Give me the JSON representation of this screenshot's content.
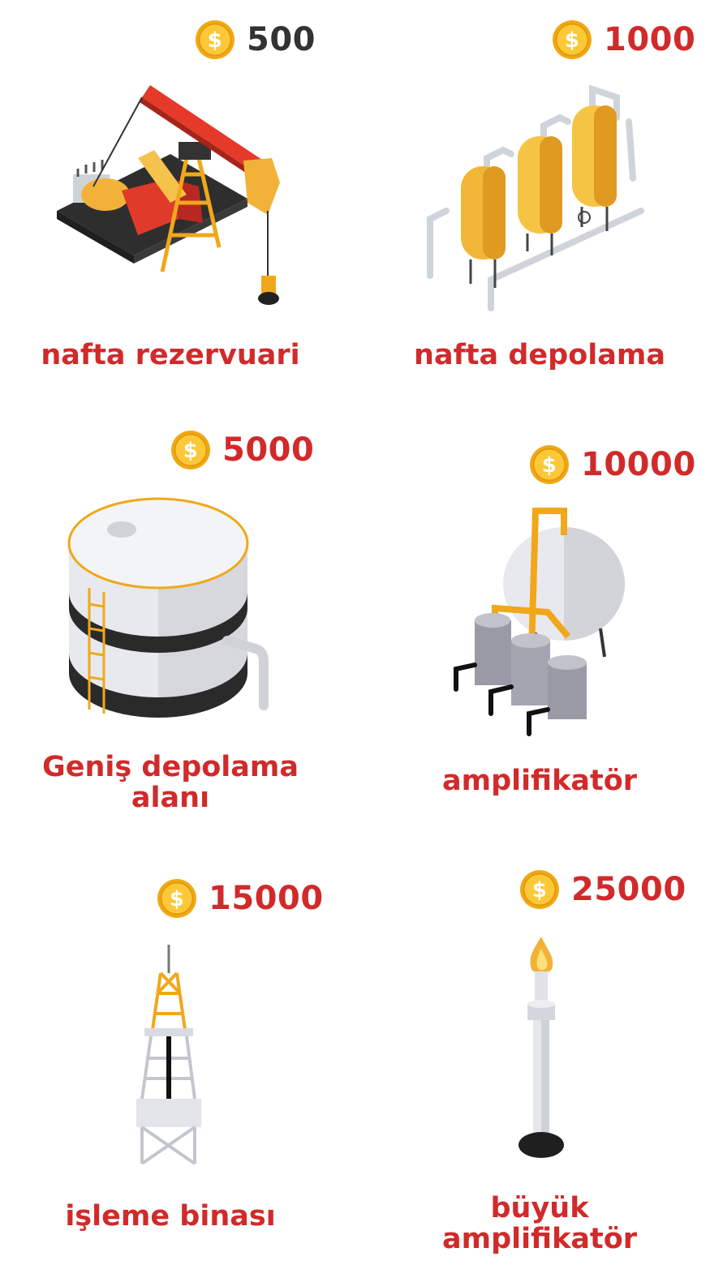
{
  "colors": {
    "label": "#d12a2a",
    "price_default": "#d12a2a",
    "price_first": "#333333",
    "coin": "#f5b21e"
  },
  "items": [
    {
      "price": "500",
      "label": "nafta rezervuari",
      "icon": "pumpjack-icon"
    },
    {
      "price": "1000",
      "label": "nafta depolama",
      "icon": "storage-tanks-icon"
    },
    {
      "price": "5000",
      "label": "Geniş depolama alanı",
      "icon": "large-tank-icon"
    },
    {
      "price": "10000",
      "label": "amplifikatör",
      "icon": "amplifier-icon"
    },
    {
      "price": "15000",
      "label": "işleme binası",
      "icon": "derrick-icon"
    },
    {
      "price": "25000",
      "label": "büyük amplifikatör",
      "icon": "flare-stack-icon"
    }
  ]
}
